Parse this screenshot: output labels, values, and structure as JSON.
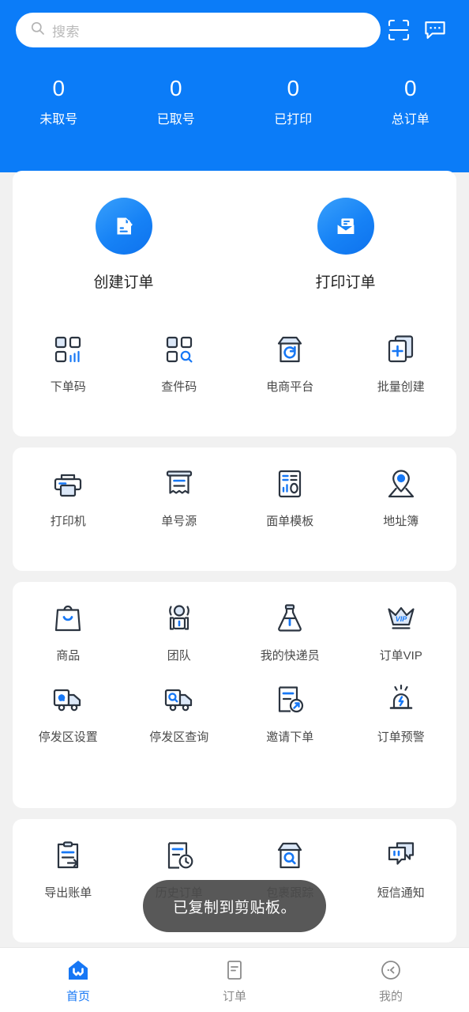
{
  "theme": {
    "brand": "#0B7CF8",
    "accent": "#1677F5",
    "card_bg": "#FFFFFF",
    "page_bg": "#F1F1F1",
    "toast_bg": "#4A4A4A"
  },
  "header": {
    "search": {
      "placeholder": "搜索",
      "value": "",
      "icon": "search-icon"
    },
    "scan_icon": "scan-icon",
    "message_icon": "message-icon",
    "stats": [
      {
        "value": "0",
        "label": "未取号"
      },
      {
        "value": "0",
        "label": "已取号"
      },
      {
        "value": "0",
        "label": "已打印"
      },
      {
        "value": "0",
        "label": "总订单"
      }
    ]
  },
  "primary_actions": [
    {
      "label": "创建订单",
      "icon": "create-order-icon"
    },
    {
      "label": "打印订单",
      "icon": "print-order-icon"
    }
  ],
  "cards": [
    {
      "name": "order-tools",
      "items": [
        {
          "label": "下单码",
          "icon": "order-code-icon"
        },
        {
          "label": "查件码",
          "icon": "track-code-icon"
        },
        {
          "label": "电商平台",
          "icon": "ecommerce-platform-icon"
        },
        {
          "label": "批量创建",
          "icon": "batch-create-icon"
        }
      ]
    },
    {
      "name": "printing-tools",
      "items": [
        {
          "label": "打印机",
          "icon": "printer-icon"
        },
        {
          "label": "单号源",
          "icon": "waybill-source-icon"
        },
        {
          "label": "面单模板",
          "icon": "waybill-template-icon"
        },
        {
          "label": "地址簿",
          "icon": "address-book-icon"
        }
      ]
    },
    {
      "name": "business-tools",
      "items": [
        {
          "label": "商品",
          "icon": "goods-icon"
        },
        {
          "label": "团队",
          "icon": "team-icon"
        },
        {
          "label": "我的快递员",
          "icon": "courier-icon"
        },
        {
          "label": "订单VIP",
          "icon": "vip-crown-icon"
        },
        {
          "label": "停发区设置",
          "icon": "restricted-area-settings-icon"
        },
        {
          "label": "停发区查询",
          "icon": "restricted-area-query-icon"
        },
        {
          "label": "邀请下单",
          "icon": "invite-order-icon"
        },
        {
          "label": "订单预警",
          "icon": "order-alert-icon"
        }
      ]
    },
    {
      "name": "records-tools",
      "items": [
        {
          "label": "导出账单",
          "icon": "export-bill-icon"
        },
        {
          "label": "历史订单",
          "icon": "history-order-icon"
        },
        {
          "label": "包裹跟踪",
          "icon": "package-tracking-icon"
        },
        {
          "label": "短信通知",
          "icon": "sms-notice-icon"
        }
      ]
    }
  ],
  "toast": {
    "message": "已复制到剪贴板。"
  },
  "tabbar": [
    {
      "label": "首页",
      "icon": "home-icon",
      "active": true
    },
    {
      "label": "订单",
      "icon": "order-list-icon",
      "active": false
    },
    {
      "label": "我的",
      "icon": "profile-icon",
      "active": false
    }
  ]
}
